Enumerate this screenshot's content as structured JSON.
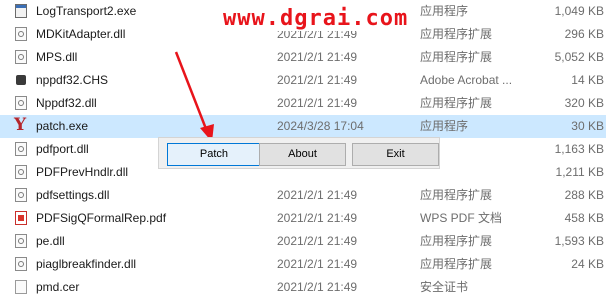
{
  "watermark": "www.dgrai.com",
  "files": [
    {
      "name": "LogTransport2.exe",
      "date": "",
      "type": "应用程序",
      "size": "1,049 KB",
      "icon": "exe-file-icon"
    },
    {
      "name": "MDKitAdapter.dll",
      "date": "2021/2/1 21:49",
      "type": "应用程序扩展",
      "size": "296 KB",
      "icon": "dll-file-icon"
    },
    {
      "name": "MPS.dll",
      "date": "2021/2/1 21:49",
      "type": "应用程序扩展",
      "size": "5,052 KB",
      "icon": "dll-file-icon"
    },
    {
      "name": "nppdf32.CHS",
      "date": "2021/2/1 21:49",
      "type": "Adobe Acrobat ...",
      "size": "14 KB",
      "icon": "chs-file-icon"
    },
    {
      "name": "Nppdf32.dll",
      "date": "2021/2/1 21:49",
      "type": "应用程序扩展",
      "size": "320 KB",
      "icon": "dll-file-icon"
    },
    {
      "name": "patch.exe",
      "date": "2024/3/28 17:04",
      "type": "应用程序",
      "size": "30 KB",
      "icon": "patch-app-icon"
    },
    {
      "name": "pdfport.dll",
      "date": "",
      "type": "",
      "size": "1,163 KB",
      "icon": "dll-file-icon"
    },
    {
      "name": "PDFPrevHndlr.dll",
      "date": "",
      "type": "",
      "size": "1,211 KB",
      "icon": "dll-file-icon"
    },
    {
      "name": "pdfsettings.dll",
      "date": "2021/2/1 21:49",
      "type": "应用程序扩展",
      "size": "288 KB",
      "icon": "dll-file-icon"
    },
    {
      "name": "PDFSigQFormalRep.pdf",
      "date": "2021/2/1 21:49",
      "type": "WPS PDF 文档",
      "size": "458 KB",
      "icon": "pdf-file-icon"
    },
    {
      "name": "pe.dll",
      "date": "2021/2/1 21:49",
      "type": "应用程序扩展",
      "size": "1,593 KB",
      "icon": "dll-file-icon"
    },
    {
      "name": "piaglbreakfinder.dll",
      "date": "2021/2/1 21:49",
      "type": "应用程序扩展",
      "size": "24 KB",
      "icon": "dll-file-icon"
    },
    {
      "name": "pmd.cer",
      "date": "2021/2/1 21:49",
      "type": "安全证书",
      "size": "",
      "icon": "generic-file-icon"
    }
  ],
  "dialog": {
    "patch_label": "Patch",
    "about_label": "About",
    "exit_label": "Exit"
  },
  "colors": {
    "watermark": "#e8141b",
    "arrow": "#e8141b",
    "selection": "#cce8ff",
    "default_button_border": "#0078d7"
  }
}
